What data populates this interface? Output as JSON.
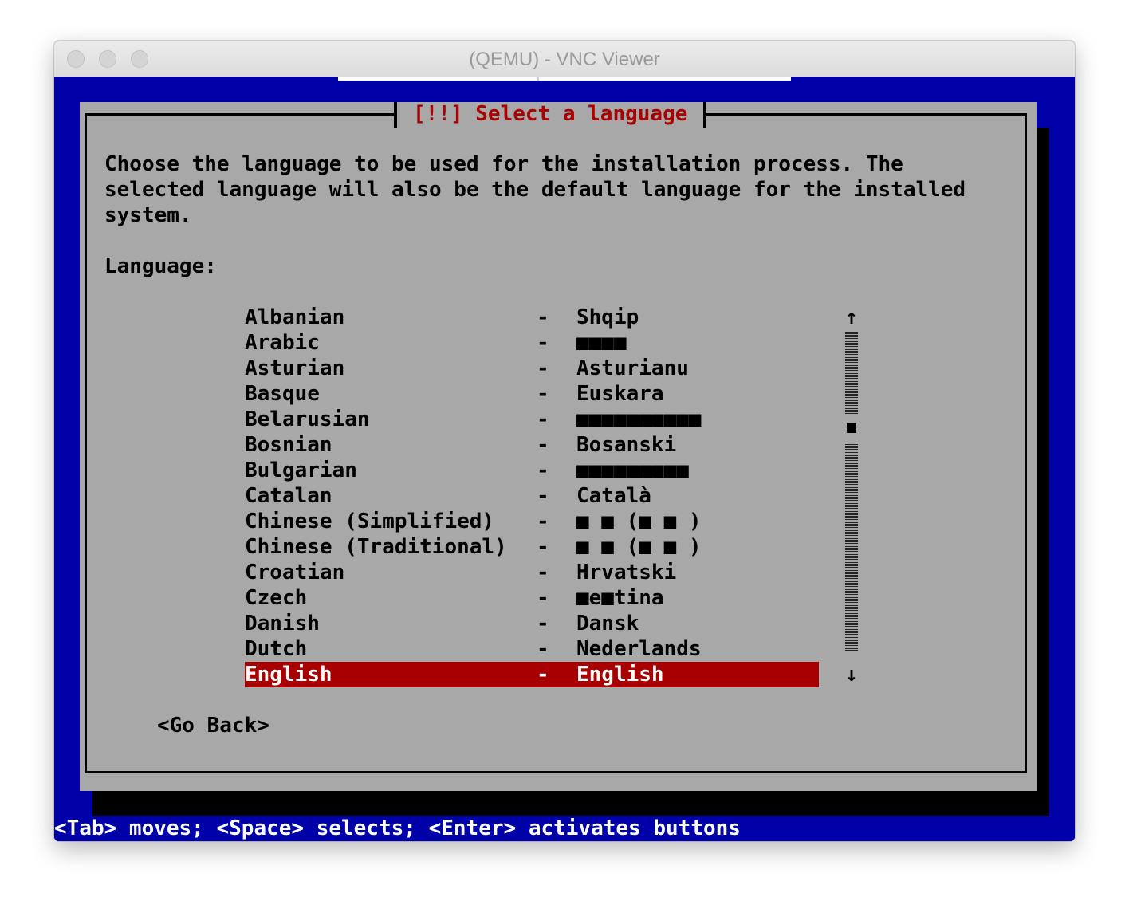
{
  "window": {
    "title": "(QEMU) - VNC Viewer"
  },
  "dialog": {
    "title": "[!!] Select a language",
    "description": "Choose the language to be used for the installation process. The selected language will also be the default language for the installed system.",
    "list_label": "Language:",
    "languages": [
      {
        "name": "Albanian",
        "native": "Shqip"
      },
      {
        "name": "Arabic",
        "native": "■■■■"
      },
      {
        "name": "Asturian",
        "native": "Asturianu"
      },
      {
        "name": "Basque",
        "native": "Euskara"
      },
      {
        "name": "Belarusian",
        "native": "■■■■■■■■■■"
      },
      {
        "name": "Bosnian",
        "native": "Bosanski"
      },
      {
        "name": "Bulgarian",
        "native": "■■■■■■■■■"
      },
      {
        "name": "Catalan",
        "native": "Català"
      },
      {
        "name": "Chinese (Simplified)",
        "native": "■ ■ (■ ■ )"
      },
      {
        "name": "Chinese (Traditional)",
        "native": "■ ■ (■ ■ )"
      },
      {
        "name": "Croatian",
        "native": "Hrvatski"
      },
      {
        "name": "Czech",
        "native": "■e■tina"
      },
      {
        "name": "Danish",
        "native": "Dansk"
      },
      {
        "name": "Dutch",
        "native": "Nederlands"
      },
      {
        "name": "English",
        "native": "English",
        "selected": true
      }
    ],
    "separator": "-",
    "scroll": {
      "up_arrow": "↑",
      "down_arrow": "↓",
      "position_fraction": 0.29
    },
    "go_back_label": "<Go Back>"
  },
  "statusbar": {
    "text": "<Tab> moves; <Space> selects; <Enter> activates buttons"
  },
  "colors": {
    "screen_bg": "#0000a8",
    "dialog_bg": "#a8a8a8",
    "accent": "#a80000",
    "text": "#000000",
    "highlight_text": "#ffffff"
  }
}
